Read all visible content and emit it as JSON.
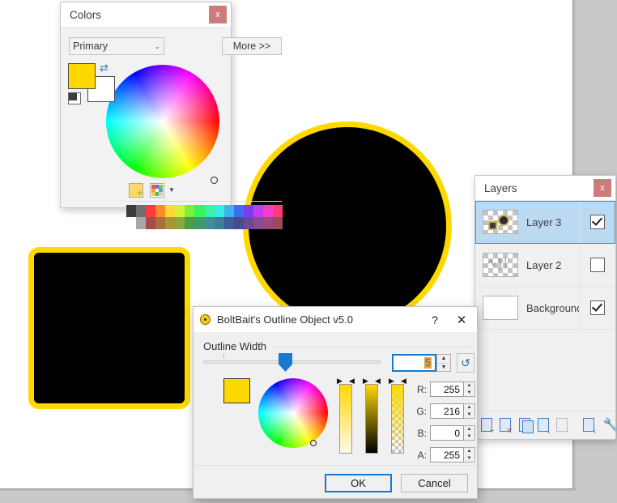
{
  "app": {
    "canvas_bg": "#ffffff",
    "workspace_bg": "#c9c9c9",
    "accent": "#1779d0",
    "outline_color": "#ffd800"
  },
  "artwork": {
    "square": {
      "name": "black-square-yellow-outline",
      "fill": "#000000",
      "outline": "#ffd800"
    },
    "circle": {
      "name": "black-circle-yellow-outline",
      "fill": "#000000",
      "outline": "#ffd800"
    }
  },
  "colors_window": {
    "title": "Colors",
    "close_label": "x",
    "mode_selector": {
      "value": "Primary",
      "chevron": "⌄"
    },
    "more_button": "More >>",
    "primary_color": "#ffd800",
    "secondary_color": "#ffffff",
    "swap_icon": "⇄",
    "add_to_palette_icon": "add-color-icon",
    "palette_icon": "palette-icon",
    "palette_caret": "▼",
    "palette_row_bright": [
      "#3c3c3c",
      "#6e6e6e",
      "#ff3b3b",
      "#ff8a2b",
      "#ffd63b",
      "#d3f13c",
      "#78f03c",
      "#3cf05e",
      "#3cf0a8",
      "#3ce8e8",
      "#3cb4f0",
      "#3c6ef0",
      "#7a3cf0",
      "#c23cf0",
      "#f53ccc",
      "#ff3b7a"
    ],
    "palette_row_muted": [
      "#ffffff",
      "#a8a8a8",
      "#a84a4a",
      "#a87038",
      "#a89438",
      "#89a83f",
      "#4f9b46",
      "#3f9b6b",
      "#3f8f96",
      "#3f7d9b",
      "#3f5d9b",
      "#4a4a93",
      "#6a4a93",
      "#8a4a93",
      "#9b4a7d",
      "#9b4a5d"
    ]
  },
  "layers_window": {
    "title": "Layers",
    "close_label": "x",
    "layers": [
      {
        "name": "Layer 3",
        "visible": true,
        "selected": true,
        "thumb": "shapes-thumb"
      },
      {
        "name": "Layer 2",
        "visible": false,
        "selected": false,
        "thumb": "scribble-thumb"
      },
      {
        "name": "Background",
        "visible": true,
        "selected": false,
        "thumb": "white-thumb"
      }
    ],
    "tools": [
      {
        "name": "add-new-layer",
        "badge": "+",
        "badge_color": "#6aa35a",
        "enabled": true
      },
      {
        "name": "delete-layer",
        "badge": "✕",
        "badge_color": "#c75b4a",
        "enabled": true
      },
      {
        "name": "duplicate-layer",
        "badge": "",
        "badge_color": "",
        "enabled": true
      },
      {
        "name": "merge-layer-down",
        "badge": "↓",
        "badge_color": "#3f7fbf",
        "enabled": true
      },
      {
        "name": "move-layer-up",
        "badge": "↑",
        "badge_color": "#c2c2c2",
        "enabled": false
      },
      {
        "name": "import-from-file",
        "badge": "↓",
        "badge_color": "#3f7fbf",
        "enabled": true
      },
      {
        "name": "layer-properties",
        "badge": "",
        "badge_color": "",
        "enabled": true
      }
    ]
  },
  "dialog": {
    "title": "BoltBait's Outline Object v5.0",
    "help_label": "?",
    "close_label": "✕",
    "section_label": "Outline Width",
    "width_value": "5",
    "slider_min": 1,
    "slider_max": 50,
    "reset_label": "↺",
    "spin_up": "▲",
    "spin_down": "▼",
    "swatch_color": "#ffd800",
    "channels": [
      {
        "label": "R:",
        "value": "255"
      },
      {
        "label": "G:",
        "value": "216"
      },
      {
        "label": "B:",
        "value": "0"
      },
      {
        "label": "A:",
        "value": "255"
      }
    ],
    "ok_label": "OK",
    "cancel_label": "Cancel"
  }
}
